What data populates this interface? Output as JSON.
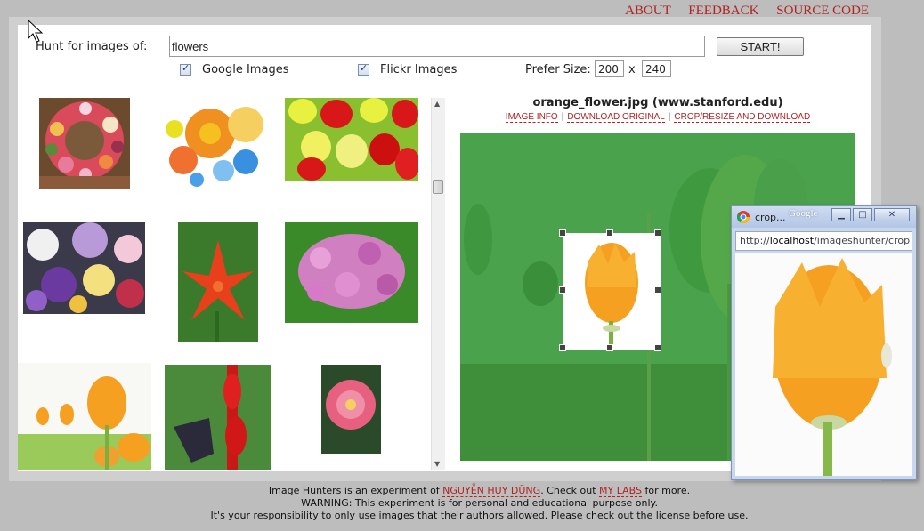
{
  "top_links": [
    "ABOUT",
    "FEEDBACK",
    "SOURCE CODE"
  ],
  "search": {
    "label": "Hunt for images of:",
    "value": "flowers",
    "start_label": "START!"
  },
  "sources": [
    {
      "label": "Google Images",
      "checked": true
    },
    {
      "label": "Flickr Images",
      "checked": true
    }
  ],
  "size": {
    "label": "Prefer Size:",
    "width": "200",
    "separator": "x",
    "height": "240"
  },
  "thumbnails": [
    {
      "name": "flower-wreath"
    },
    {
      "name": "painted-flowers"
    },
    {
      "name": "red-yellow-tulips"
    },
    {
      "name": "flower-bouquet"
    },
    {
      "name": "red-lily"
    },
    {
      "name": "pink-spirea"
    },
    {
      "name": "orange-tulips-field"
    },
    {
      "name": "butterfly-red-flower"
    },
    {
      "name": "pink-camellia"
    }
  ],
  "preview": {
    "title": "orange_flower.jpg (www.stanford.edu)",
    "links": [
      "IMAGE INFO",
      "DOWNLOAD ORIGINAL",
      "CROP/RESIZE AND DOWNLOAD"
    ]
  },
  "popup": {
    "title": "crop...",
    "watermark": "Google",
    "url_prefix": "http://",
    "url_host": "localhost",
    "url_path": "/imageshunter/crop"
  },
  "footer": {
    "line1_a": "Image Hunters is an experiment of ",
    "author": "NGUYỄN HUY DŨNG",
    "line1_b": ". Check out ",
    "labs": "MY LABS",
    "line1_c": " for more.",
    "line2": "WARNING: This experiment is for personal and educational purpose only.",
    "line3": "It's your responsibility to only use images that their authors allowed. Please check out the license before use."
  },
  "colors": {
    "link": "#b22222",
    "panel": "#cfcfcf",
    "background": "#bdbdbd"
  }
}
